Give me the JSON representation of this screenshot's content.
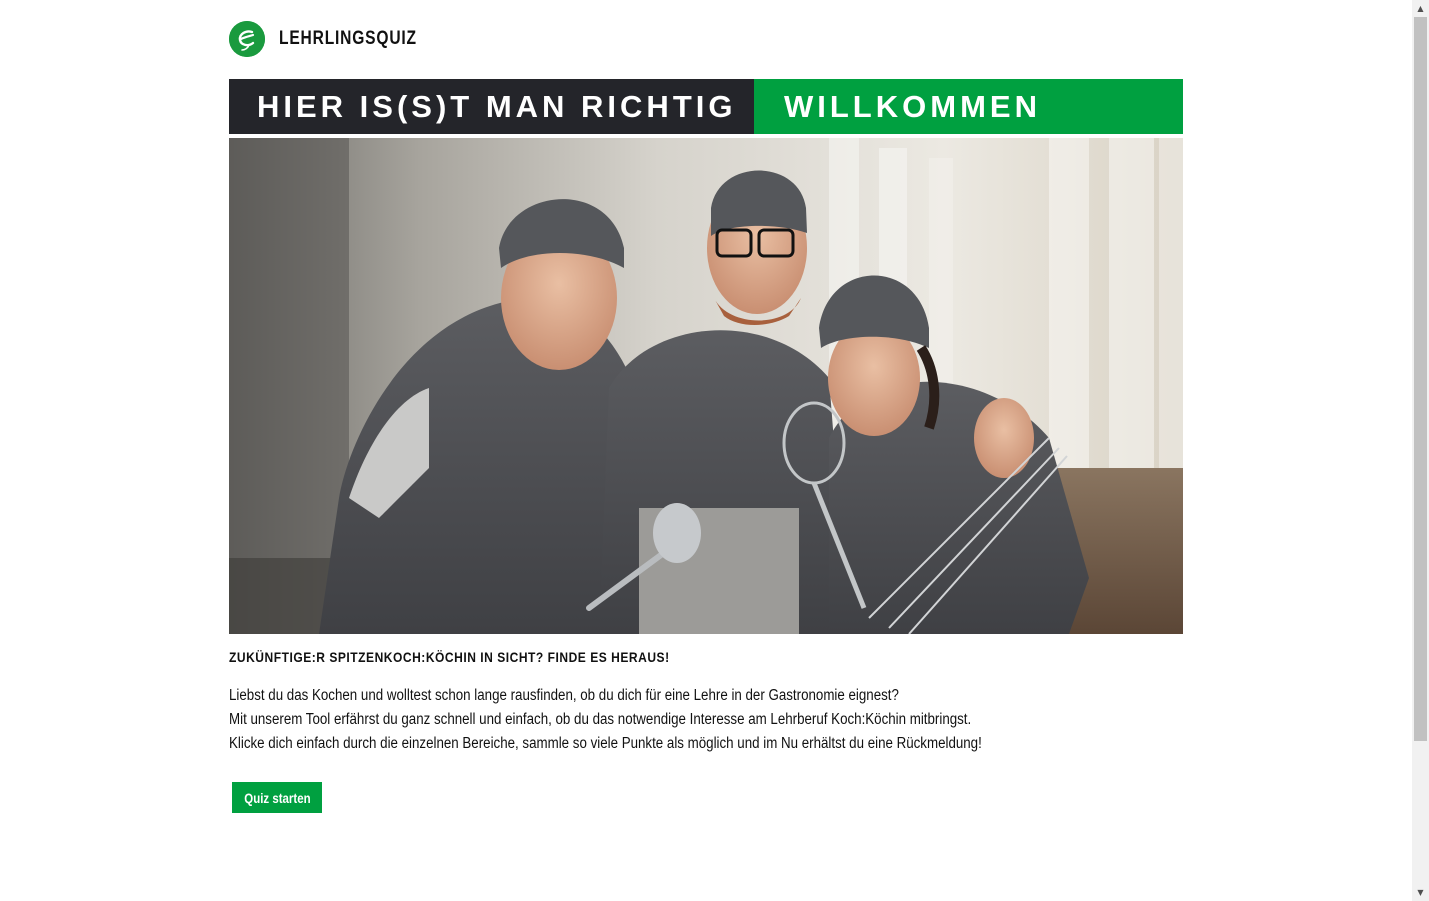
{
  "header": {
    "logo_icon": "eurest-logo-icon",
    "title": "LEHRLINGSQUIZ"
  },
  "banner": {
    "left_text": "HIER IS(S)T MAN RICHTIG",
    "right_text": "WILLKOMMEN",
    "left_color": "#24252a",
    "right_color": "#00a040"
  },
  "hero": {
    "image_icon": "chef-team-photo"
  },
  "main": {
    "subtitle": "ZUKÜNFTIGE:R SPITZENKOCH:KÖCHIN IN SICHT? FINDE ES HERAUS!",
    "paragraphs": [
      "Liebst du das Kochen und wolltest schon lange rausfinden, ob du dich für eine Lehre in der Gastronomie eignest?",
      "Mit unserem Tool erfährst du ganz schnell und einfach, ob du das notwendige Interesse am Lehrberuf Koch:Köchin mitbringst.",
      "Klicke dich einfach durch die einzelnen Bereiche, sammle so viele Punkte als möglich und im Nu erhältst du eine Rückmeldung!"
    ],
    "start_button": "Quiz starten"
  },
  "colors": {
    "accent": "#00a040",
    "dark": "#24252a"
  }
}
